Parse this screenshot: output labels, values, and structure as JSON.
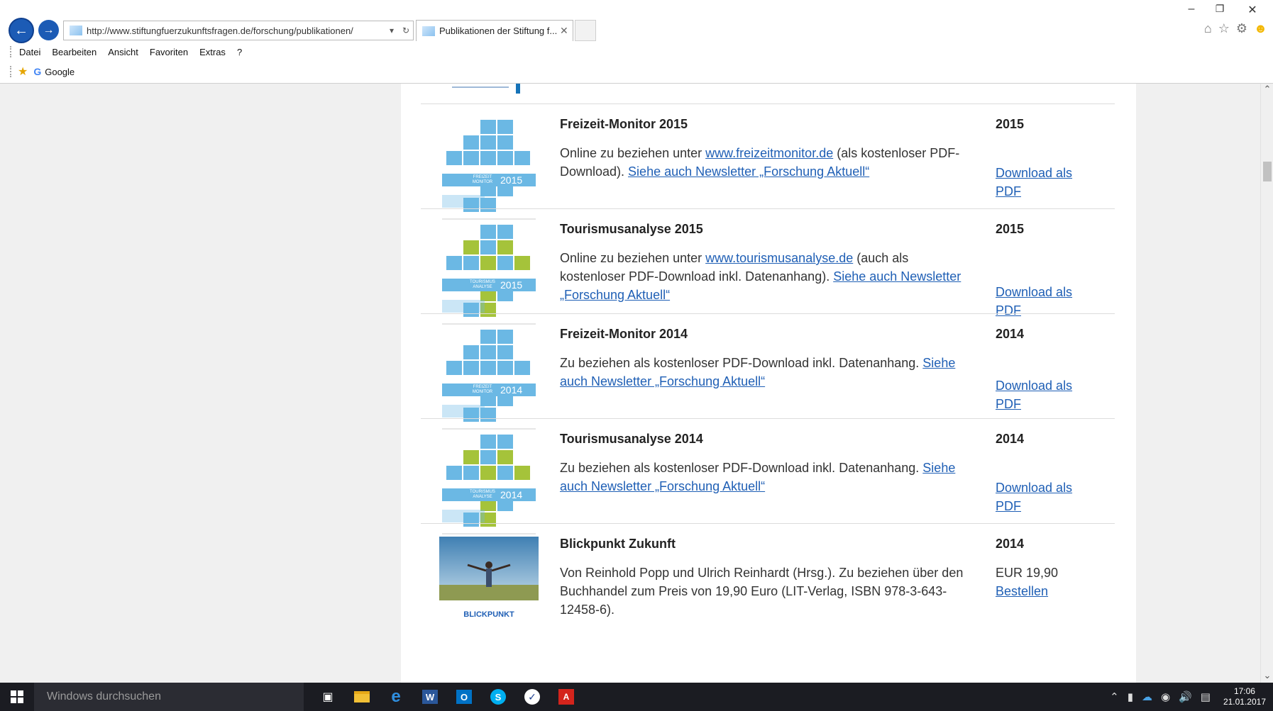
{
  "browser": {
    "url": "http://www.stiftungfuerzukunftsfragen.de/forschung/publikationen/",
    "tab_title": "Publikationen der Stiftung f...",
    "menu": [
      "Datei",
      "Bearbeiten",
      "Ansicht",
      "Favoriten",
      "Extras",
      "?"
    ],
    "favorites": [
      "Google"
    ],
    "icons": [
      "back-icon",
      "forward-icon",
      "refresh-icon",
      "home-icon",
      "star-icon",
      "gear-icon",
      "smiley-icon"
    ]
  },
  "publications": [
    {
      "title": "Freizeit-Monitor 2015",
      "year": "2015",
      "desc_pre": " Online zu beziehen unter ",
      "link1": "www.freizeitmonitor.de",
      "desc_mid": " (als kostenloser PDF-Download). ",
      "link2": "Siehe auch Newsletter „Forschung Aktuell“",
      "action": "Download als PDF",
      "cover": {
        "label": "FREIZEIT MONITOR",
        "year": "2015",
        "accent": "#6bb8e4"
      }
    },
    {
      "title": "Tourismusanalyse 2015",
      "year": "2015",
      "desc_pre": "Online zu beziehen unter ",
      "link1": "www.tourismusanalyse.de",
      "desc_mid": " (auch als kostenloser PDF-Download inkl. Datenanhang). ",
      "link2": "Siehe auch Newsletter „Forschung Aktuell“",
      "action": "Download als PDF",
      "cover": {
        "label": "TOURISMUS ANALYSE",
        "year": "2015",
        "accent": "#a5c33a"
      }
    },
    {
      "title": "Freizeit-Monitor 2014",
      "year": "2014",
      "desc_pre": " Zu beziehen als kostenloser PDF-Download inkl. Datenanhang. ",
      "link2": "Siehe auch Newsletter „Forschung Aktuell“",
      "action": "Download als PDF",
      "cover": {
        "label": "FREIZEIT MONITOR",
        "year": "2014",
        "accent": "#6bb8e4"
      }
    },
    {
      "title": "Tourismusanalyse 2014",
      "year": "2014",
      "desc_pre": "Zu beziehen als kostenloser PDF-Download inkl. Datenanhang. ",
      "link2": "Siehe auch Newsletter „Forschung Aktuell“",
      "action": "Download als PDF",
      "cover": {
        "label": "TOURISMUS ANALYSE",
        "year": "2014",
        "accent": "#a5c33a"
      }
    },
    {
      "title": "Blickpunkt Zukunft",
      "year": "2014",
      "desc_pre": "Von Reinhold Popp und Ulrich Reinhardt (Hrsg.). Zu beziehen über den Buchhandel zum Preis von 19,90 Euro (LIT-Verlag, ISBN 978-3-643-12458-6).",
      "price": "EUR 19,90",
      "action": "Bestellen",
      "cover": {
        "label": "BLICKPUNKT",
        "year": ""
      }
    }
  ],
  "taskbar": {
    "search_placeholder": "Windows durchsuchen",
    "time": "17:06",
    "date": "21.01.2017",
    "apps": [
      "task-view-icon",
      "file-explorer-icon",
      "edge-icon",
      "word-icon",
      "outlook-icon",
      "skype-icon",
      "checkmark-app-icon",
      "acrobat-icon"
    ]
  }
}
